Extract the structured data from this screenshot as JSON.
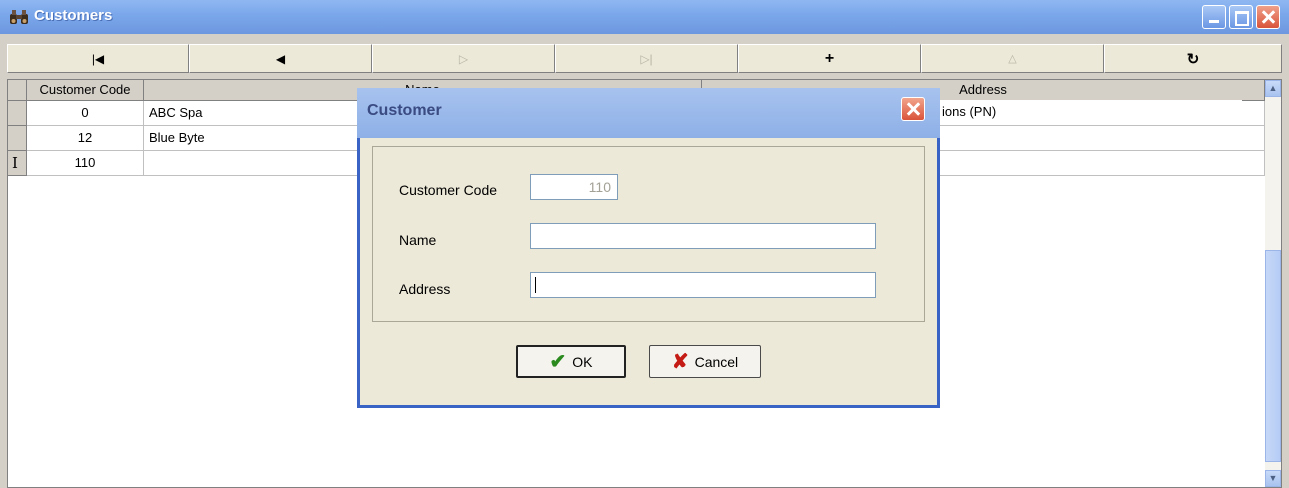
{
  "window": {
    "title": "Customers",
    "icon": "binoculars-icon"
  },
  "navigator": {
    "buttons": [
      {
        "name": "first-record",
        "glyph": "⏮",
        "enabled": true
      },
      {
        "name": "prior-record",
        "glyph": "◀",
        "enabled": true
      },
      {
        "name": "next-record",
        "glyph": "▷",
        "enabled": false
      },
      {
        "name": "last-record",
        "glyph": "⊳|",
        "enabled": false
      },
      {
        "name": "insert-record",
        "glyph": "✚",
        "enabled": true
      },
      {
        "name": "post-edit",
        "glyph": "△",
        "enabled": false
      },
      {
        "name": "refresh-data",
        "glyph": "↻",
        "enabled": true
      }
    ]
  },
  "grid": {
    "columns": [
      "Customer Code",
      "Name",
      "Address"
    ],
    "rows": [
      {
        "code": "0",
        "name": "ABC Spa",
        "address": "...ions (PN)"
      },
      {
        "code": "12",
        "name": "Blue Byte",
        "address": ""
      },
      {
        "code": "110",
        "name": "",
        "address": ""
      }
    ]
  },
  "dialog": {
    "title": "Customer",
    "fields": {
      "code_label": "Customer Code",
      "code_value": "110",
      "name_label": "Name",
      "name_value": "",
      "address_label": "Address",
      "address_value": ""
    },
    "ok_label": "OK",
    "cancel_label": "Cancel"
  },
  "colors": {
    "title_bar": "#7aa6ea",
    "dialog_border": "#3a63c6",
    "ok_icon": "#2a8a1e",
    "cancel_icon": "#c41b14"
  }
}
